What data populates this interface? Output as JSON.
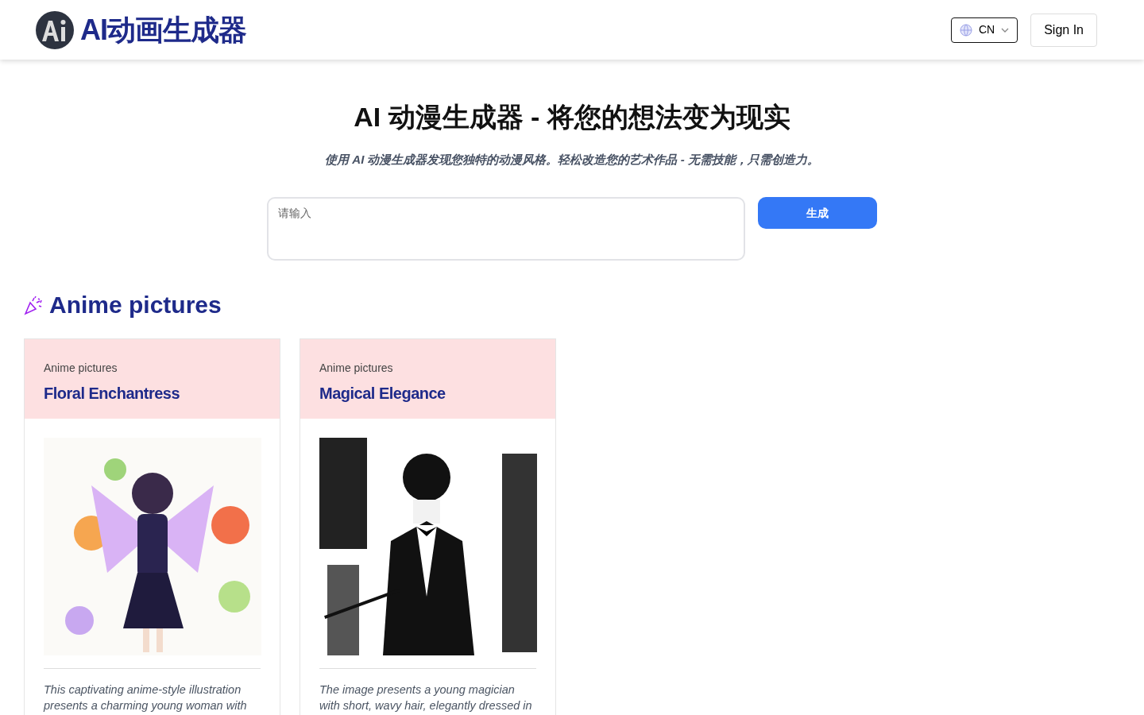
{
  "header": {
    "logo_text": "AI动画生成器",
    "language": {
      "label": "CN"
    },
    "sign_in": "Sign In"
  },
  "hero": {
    "title": "AI 动漫生成器 - 将您的想法变为现实",
    "subtitle": "使用 AI 动漫生成器发现您独特的动漫风格。轻松改造您的艺术作品 - 无需技能，只需创造力。",
    "prompt": {
      "placeholder": "请输入"
    },
    "generate_button": "生成"
  },
  "section": {
    "title": "Anime pictures",
    "cards": [
      {
        "category": "Anime pictures",
        "title": "Floral Enchantress",
        "description": "This captivating anime-style illustration presents a charming young woman with"
      },
      {
        "category": "Anime pictures",
        "title": "Magical Elegance",
        "description": "The image presents a young magician with short, wavy hair, elegantly dressed in"
      }
    ]
  }
}
